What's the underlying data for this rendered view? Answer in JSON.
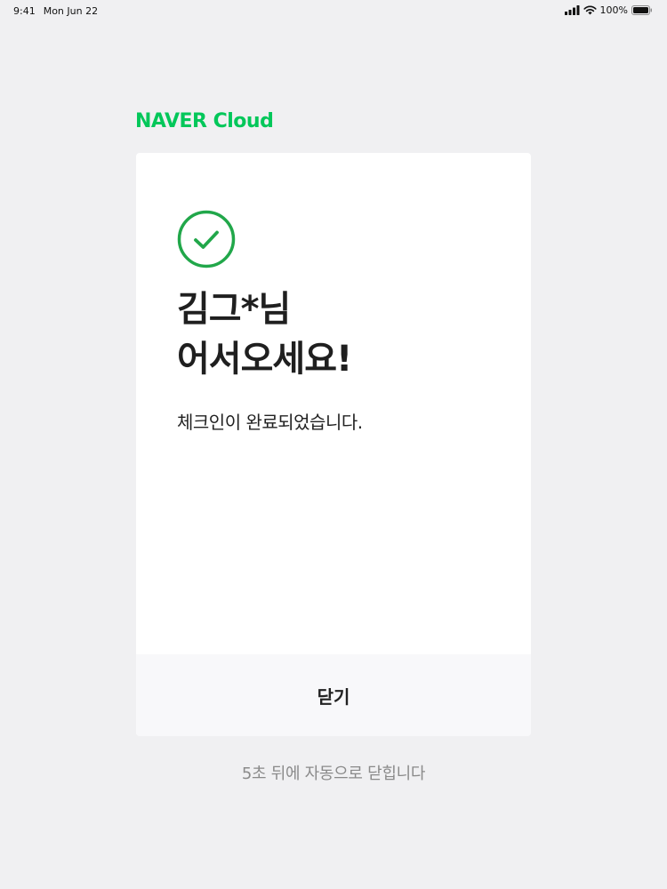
{
  "status_bar": {
    "time": "9:41",
    "date": "Mon Jun 22",
    "battery": "100%"
  },
  "brand": {
    "logo_text": "NAVER Cloud",
    "color": "#03c75a"
  },
  "card": {
    "icon": "check-circle-icon",
    "greeting_line1": "김그*님",
    "greeting_line2": "어서오세요!",
    "message": "체크인이 완료되었습니다.",
    "close_label": "닫기"
  },
  "auto_close_text": "5초 뒤에 자동으로 닫힙니다",
  "colors": {
    "accent": "#03c75a",
    "background": "#f0f0f2",
    "card": "#ffffff",
    "footer": "#f8f8fa",
    "muted_text": "#8a8a8a"
  }
}
